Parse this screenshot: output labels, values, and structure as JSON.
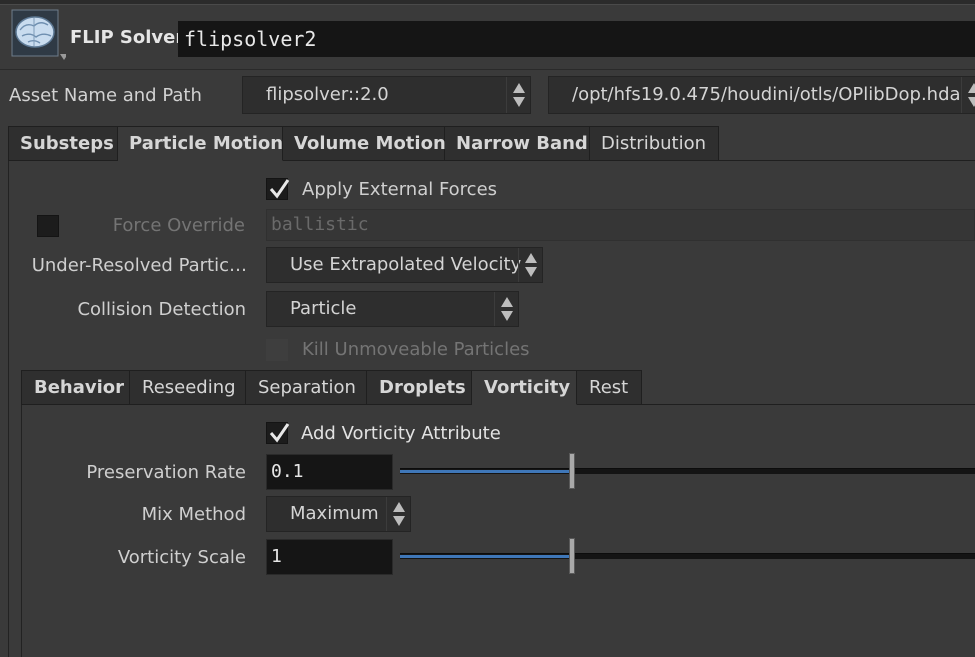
{
  "header": {
    "node_type": "FLIP Solver",
    "node_name": "flipsolver2",
    "icon": "brain-icon"
  },
  "asset": {
    "label": "Asset Name and Path",
    "name": "flipsolver::2.0",
    "path": "/opt/hfs19.0.475/houdini/otls/OPlibDop.hda"
  },
  "tabs": [
    {
      "label": "Substeps"
    },
    {
      "label": "Particle Motion"
    },
    {
      "label": "Volume Motion"
    },
    {
      "label": "Narrow Band"
    },
    {
      "label": "Distribution"
    }
  ],
  "particle_motion": {
    "apply_external_forces": {
      "label": "Apply External Forces",
      "checked": true
    },
    "force_override": {
      "label": "Force Override",
      "value": "ballistic",
      "enabled": false
    },
    "under_resolved": {
      "label": "Under-Resolved Partic…",
      "value": "Use Extrapolated Velocity"
    },
    "collision_detection": {
      "label": "Collision Detection",
      "value": "Particle"
    },
    "kill_unmoveable": {
      "label": "Kill Unmoveable Particles",
      "checked": false,
      "enabled": false
    }
  },
  "subtabs": [
    {
      "label": "Behavior"
    },
    {
      "label": "Reseeding"
    },
    {
      "label": "Separation"
    },
    {
      "label": "Droplets"
    },
    {
      "label": "Vorticity"
    },
    {
      "label": "Rest"
    }
  ],
  "vorticity": {
    "add_attribute": {
      "label": "Add Vorticity Attribute",
      "checked": true
    },
    "preservation_rate": {
      "label": "Preservation Rate",
      "value": "0.1",
      "slider_fraction": 0.3
    },
    "mix_method": {
      "label": "Mix Method",
      "value": "Maximum"
    },
    "vorticity_scale": {
      "label": "Vorticity Scale",
      "value": "1",
      "slider_fraction": 0.3
    }
  },
  "colors": {
    "background": "#3a3a3a",
    "field": "#151515",
    "slider_accent": "#3f77b8"
  }
}
